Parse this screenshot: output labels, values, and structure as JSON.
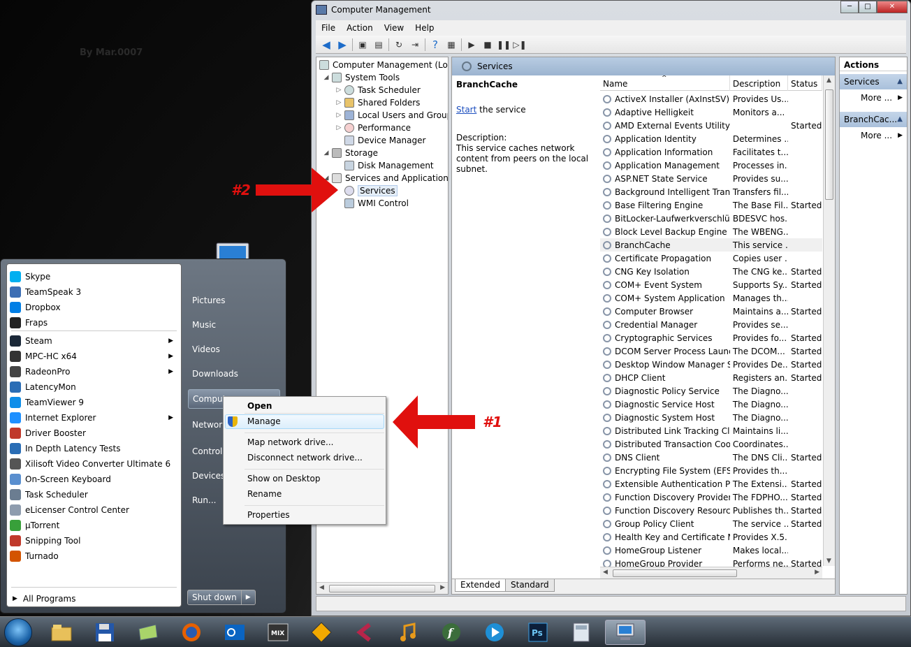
{
  "desktop": {
    "watermark": "By Mar.0007"
  },
  "window": {
    "title": "Computer Management",
    "controls": {
      "minimize": "─",
      "maximize": "□",
      "close": "✕"
    },
    "menu": [
      "File",
      "Action",
      "View",
      "Help"
    ],
    "tree": {
      "root": "Computer Management (Local",
      "system_tools": "System Tools",
      "task_scheduler": "Task Scheduler",
      "shared_folders": "Shared Folders",
      "local_users": "Local Users and Groups",
      "performance": "Performance",
      "device_manager": "Device Manager",
      "storage": "Storage",
      "disk_management": "Disk Management",
      "services_apps": "Services and Applications",
      "services": "Services",
      "wmi": "WMI Control"
    },
    "center": {
      "header": "Services",
      "selected_service": "BranchCache",
      "start_link": "Start",
      "start_suffix": " the service",
      "desc_label": "Description:",
      "description": "This service caches network content from peers on the local subnet.",
      "columns": {
        "name": "Name",
        "description": "Description",
        "status": "Status"
      },
      "rows": [
        {
          "name": "ActiveX Installer (AxInstSV)",
          "desc": "Provides Us...",
          "status": ""
        },
        {
          "name": "Adaptive Helligkeit",
          "desc": "Monitors a...",
          "status": ""
        },
        {
          "name": "AMD External Events Utility",
          "desc": "",
          "status": "Started"
        },
        {
          "name": "Application Identity",
          "desc": "Determines ...",
          "status": ""
        },
        {
          "name": "Application Information",
          "desc": "Facilitates t...",
          "status": ""
        },
        {
          "name": "Application Management",
          "desc": "Processes in...",
          "status": ""
        },
        {
          "name": "ASP.NET State Service",
          "desc": "Provides su...",
          "status": ""
        },
        {
          "name": "Background Intelligent Trans...",
          "desc": "Transfers fil...",
          "status": ""
        },
        {
          "name": "Base Filtering Engine",
          "desc": "The Base Fil...",
          "status": "Started"
        },
        {
          "name": "BitLocker-Laufwerkverschlüs...",
          "desc": "BDESVC hos...",
          "status": ""
        },
        {
          "name": "Block Level Backup Engine S...",
          "desc": "The WBENG...",
          "status": ""
        },
        {
          "name": "BranchCache",
          "desc": "This service ...",
          "status": ""
        },
        {
          "name": "Certificate Propagation",
          "desc": "Copies user ...",
          "status": ""
        },
        {
          "name": "CNG Key Isolation",
          "desc": "The CNG ke...",
          "status": "Started"
        },
        {
          "name": "COM+ Event System",
          "desc": "Supports Sy...",
          "status": "Started"
        },
        {
          "name": "COM+ System Application",
          "desc": "Manages th...",
          "status": ""
        },
        {
          "name": "Computer Browser",
          "desc": "Maintains a...",
          "status": "Started"
        },
        {
          "name": "Credential Manager",
          "desc": "Provides se...",
          "status": ""
        },
        {
          "name": "Cryptographic Services",
          "desc": "Provides fo...",
          "status": "Started"
        },
        {
          "name": "DCOM Server Process Launc...",
          "desc": "The DCOM...",
          "status": "Started"
        },
        {
          "name": "Desktop Window Manager S...",
          "desc": "Provides De...",
          "status": "Started"
        },
        {
          "name": "DHCP Client",
          "desc": "Registers an...",
          "status": "Started"
        },
        {
          "name": "Diagnostic Policy Service",
          "desc": "The Diagno...",
          "status": ""
        },
        {
          "name": "Diagnostic Service Host",
          "desc": "The Diagno...",
          "status": ""
        },
        {
          "name": "Diagnostic System Host",
          "desc": "The Diagno...",
          "status": ""
        },
        {
          "name": "Distributed Link Tracking Cli...",
          "desc": "Maintains li...",
          "status": ""
        },
        {
          "name": "Distributed Transaction Coor...",
          "desc": "Coordinates...",
          "status": ""
        },
        {
          "name": "DNS Client",
          "desc": "The DNS Cli...",
          "status": "Started"
        },
        {
          "name": "Encrypting File System (EFS)",
          "desc": "Provides th...",
          "status": ""
        },
        {
          "name": "Extensible Authentication Pr...",
          "desc": "The Extensi...",
          "status": "Started"
        },
        {
          "name": "Function Discovery Provider ...",
          "desc": "The FDPHO...",
          "status": "Started"
        },
        {
          "name": "Function Discovery Resource...",
          "desc": "Publishes th...",
          "status": "Started"
        },
        {
          "name": "Group Policy Client",
          "desc": "The service ...",
          "status": "Started"
        },
        {
          "name": "Health Key and Certificate M...",
          "desc": "Provides X.5...",
          "status": ""
        },
        {
          "name": "HomeGroup Listener",
          "desc": "Makes local...",
          "status": ""
        },
        {
          "name": "HomeGroup Provider",
          "desc": "Performs ne...",
          "status": "Started"
        }
      ],
      "tabs": {
        "extended": "Extended",
        "standard": "Standard"
      }
    },
    "actions": {
      "header": "Actions",
      "section1": "Services",
      "more1": "More ...",
      "section2": "BranchCac...",
      "more2": "More ..."
    }
  },
  "start_menu": {
    "programs": [
      {
        "label": "Skype",
        "color": "#00aff0",
        "sub": false
      },
      {
        "label": "TeamSpeak 3",
        "color": "#3c6eb4",
        "sub": false
      },
      {
        "label": "Dropbox",
        "color": "#007ee5",
        "sub": false
      },
      {
        "label": "Fraps",
        "color": "#222222",
        "sub": false
      },
      {
        "label": "Steam",
        "color": "#1b2838",
        "sub": true
      },
      {
        "label": "MPC-HC x64",
        "color": "#333333",
        "sub": true
      },
      {
        "label": "RadeonPro",
        "color": "#444444",
        "sub": true
      },
      {
        "label": "LatencyMon",
        "color": "#2a6db5",
        "sub": false
      },
      {
        "label": "TeamViewer 9",
        "color": "#0e8ee9",
        "sub": false
      },
      {
        "label": "Internet Explorer",
        "color": "#1e90ff",
        "sub": true
      },
      {
        "label": "Driver Booster",
        "color": "#c0392b",
        "sub": false
      },
      {
        "label": "In Depth Latency Tests",
        "color": "#2a6db5",
        "sub": false
      },
      {
        "label": "Xilisoft Video Converter Ultimate 6",
        "color": "#555555",
        "sub": false
      },
      {
        "label": "On-Screen Keyboard",
        "color": "#5a8fcf",
        "sub": false
      },
      {
        "label": "Task Scheduler",
        "color": "#6b7d91",
        "sub": false
      },
      {
        "label": "eLicenser Control Center",
        "color": "#8e9cae",
        "sub": false
      },
      {
        "label": "µTorrent",
        "color": "#38a03a",
        "sub": false
      },
      {
        "label": "Snipping Tool",
        "color": "#c0392b",
        "sub": false
      },
      {
        "label": "Turnado",
        "color": "#d35400",
        "sub": false
      }
    ],
    "all_programs": "All Programs",
    "right": {
      "pictures": "Pictures",
      "music": "Music",
      "videos": "Videos",
      "downloads": "Downloads",
      "computer": "Comput",
      "network": "Network",
      "control": "Control I",
      "devices": "Devices a",
      "run": "Run..."
    },
    "shutdown": "Shut down"
  },
  "context_menu": {
    "open": "Open",
    "manage": "Manage",
    "map_drive": "Map network drive...",
    "disconnect_drive": "Disconnect network drive...",
    "show_desktop": "Show on Desktop",
    "rename": "Rename",
    "properties": "Properties"
  },
  "annotations": {
    "one": "#1",
    "two": "#2",
    "color": "#e0100e"
  },
  "taskbar": {
    "icons": [
      "explorer-icon",
      "floppy-icon",
      "folder-icon",
      "firefox-icon",
      "outlook-icon",
      "mixcraft-icon",
      "fl-icon",
      "cubase-icon",
      "music-icon",
      "flstudio-icon",
      "media-icon",
      "photoshop-icon",
      "calculator-icon",
      "computer-management-icon"
    ],
    "ps_label": "Ps",
    "f_label": "f",
    "mix_label": "MIX"
  }
}
